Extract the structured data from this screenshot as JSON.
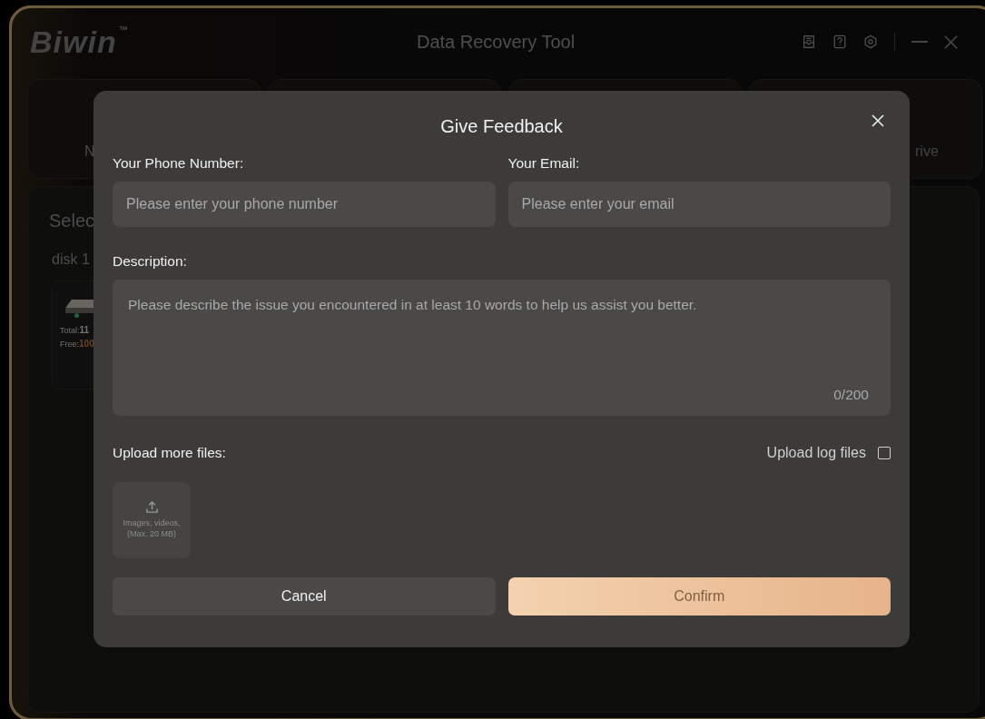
{
  "window": {
    "logo": "Biwin",
    "trademark": "™",
    "title": "Data Recovery Tool"
  },
  "tabs": {
    "first_label": "N",
    "last_label": "rive"
  },
  "panel": {
    "heading": "Selec",
    "disk_label": "disk 1",
    "disk": {
      "total": "Total:**11**",
      "free": "Free:**100**"
    }
  },
  "dialog": {
    "title": "Give Feedback",
    "fields": [
      {
        "label": "Your Phone Number:",
        "placeholder": "Please enter your phone number"
      },
      {
        "label": "Your Email:",
        "placeholder": "Please enter your email"
      }
    ],
    "description": {
      "label": "Description:",
      "placeholder": "Please describe the issue you encountered in at least 10 words to help us assist you better.",
      "counter": "0/200"
    },
    "upload": {
      "label": "Upload more files:",
      "hint_lines": [
        "Images, videos,",
        "(Max. 20 MB)"
      ]
    },
    "log_option": {
      "label": "Upload log files",
      "checked": false
    },
    "buttons": [
      {
        "label": "Cancel",
        "kind": "secondary",
        "disabled": false
      },
      {
        "label": "Confirm",
        "kind": "primary",
        "disabled": true
      }
    ]
  }
}
